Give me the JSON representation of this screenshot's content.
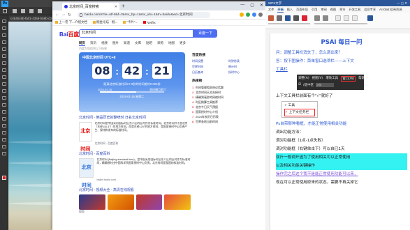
{
  "photoshop": {
    "doc_tab": "c4b45c8b-fa01-4359-b58b-d2a4b ...",
    "logo": "Ps"
  },
  "browser": {
    "tab_title": "北京时间_百度搜索",
    "url": "baidu.com/s?ie=utf-8&f=3&rsv_bp=1&rsv_idx=1&tn=baidu&wd=北京时间",
    "bookmarks": [
      "上一卷 下...介绍文档",
      "掘金论坛 - 掘...",
      "\"卡片\"...",
      "Netflix"
    ],
    "window_controls": [
      "—",
      "▢",
      "✕"
    ]
  },
  "baidu": {
    "logo_left": "Bai",
    "logo_right": "百度",
    "search_value": "北京时间",
    "search_button": "百度一下",
    "tabs": [
      "网页",
      "资讯",
      "视频",
      "图片",
      "知道",
      "文库",
      "贴吧",
      "采购",
      "地图",
      "更多"
    ],
    "active_tab": "网页",
    "results_count": "百度为您找到以下结果",
    "clock": {
      "header": "中国北京时间 UTC+8",
      "hour": "08",
      "minute": "42",
      "second": "21",
      "sub": "距离北京标准时间17.0秒的时间差约0.001秒",
      "info_left": "2024-01-16",
      "info_right": "农历腊月初六",
      "date": "2024-01-16 星期二"
    },
    "sidebar_title": "百度热搜",
    "sidebar_links": [
      "时间设置",
      "时钟秒表",
      "世界时间",
      "倒计时",
      "日历查询",
      "授时中心"
    ],
    "hot_title": "热搜榜",
    "hot_list": [
      {
        "rank": "1",
        "text": "时间管理相关热议话题"
      },
      {
        "rank": "2",
        "text": "北京时间天文台授时"
      },
      {
        "rank": "3",
        "text": "精确到毫秒的网络时间"
      },
      {
        "rank": "4",
        "text": "时区换算工具推荐"
      },
      {
        "rank": "5",
        "text": "北京今日天气预报"
      },
      {
        "rank": "6",
        "text": "国家授时中心介绍"
      },
      {
        "rank": "7",
        "text": "2024年农历日历表"
      },
      {
        "rank": "8",
        "text": "世界各地当前时间"
      }
    ],
    "results": [
      {
        "title": "北京时间 - 倒品历史的聚喷时 日名北京时间",
        "thumb": "北京时间",
        "desc": "北京时间是中国采用国际时区东八区的区时作为标准时间。北京时间并不是北京（东经116.4°）的地方时间，而是东经120°的地方时间，是国家授时中心负责产生、保持和发布的标准时间。",
        "source": "北京时间 - 百度百科"
      },
      {
        "title": "北京时间 - 百度百科",
        "thumb": "北京时间",
        "desc": "北京时间 (Beijing standard time)，是中国采用国际时区东八区的区时作为标准时间，精确授时由中国科学院国家授时中心负责。北京时间是我国的标准时间。",
        "source": "baike.baidu.com"
      },
      {
        "title": "北京时间 - 视频大全 - 高清在线观看",
        "source": "视频"
      }
    ]
  },
  "word": {
    "title": "WPS文字",
    "menu": [
      "文件",
      "开始",
      "插入",
      "页面布局",
      "引用",
      "审阅",
      "视图",
      "章节",
      "开发工具",
      "会员专享",
      "Acrobat 稻壳资源"
    ],
    "active_menu": "开始",
    "heading": "PSAI 每日一问",
    "lines": [
      "问：调整工具栏消失了，怎么调出来？",
      "答：按下图操作：菜单窗口选项栏——上下文",
      "工具栏",
      "上下文工具栏前面有个\"√\"就好了",
      "Ps自带那种看框，才能正常使用相关功能",
      "调出功能方法：",
      "调对功能框（1点-1点失败）",
      "调对功能框（右键单击下）可以自已1天",
      "双斤一般调开因为了使用相关可以正常使用",
      "以及相关功能关键操作",
      "操作完之后这个我不是能正常使用功能可以来，",
      "现在可以正常使用原来的状态，需要不再关掉它"
    ],
    "shot_menu": [
      "窗口",
      "帮助(H)",
      "调整(A)",
      "视图(V)",
      "增效工具",
      "窗口(W)",
      "帮助(H)"
    ],
    "shot_row2": [
      "☑",
      "/选中区",
      "选择"
    ],
    "menu_items": [
      "✓ 工具",
      "✓ 上下文任务栏"
    ]
  }
}
